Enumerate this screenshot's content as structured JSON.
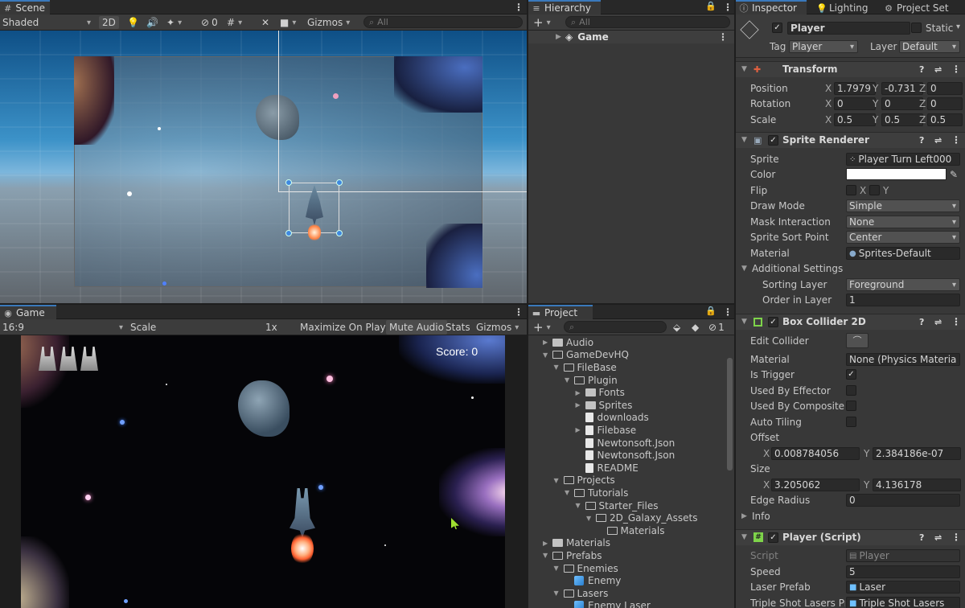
{
  "scene": {
    "tab": "Scene",
    "shading": "Shaded",
    "mode2d": "2D",
    "hidden_count": "0",
    "gizmos": "Gizmos",
    "search_placeholder": "All"
  },
  "game": {
    "tab": "Game",
    "aspect": "16:9",
    "scale_label": "Scale",
    "scale_value": "1x",
    "maximize": "Maximize On Play",
    "mute": "Mute Audio",
    "stats": "Stats",
    "gizmos": "Gizmos",
    "score": "Score: 0",
    "scale_level": 0.0
  },
  "hierarchy": {
    "tab": "Hierarchy",
    "search_placeholder": "All",
    "scene_name": "Game"
  },
  "project": {
    "tab": "Project",
    "hidden_count": "1",
    "items": [
      {
        "label": "Audio",
        "depth": 0,
        "kind": "folder",
        "open": false,
        "arrow": "closed"
      },
      {
        "label": "GameDevHQ",
        "depth": 0,
        "kind": "folder",
        "open": true,
        "arrow": "open"
      },
      {
        "label": "FileBase",
        "depth": 1,
        "kind": "folder",
        "open": true,
        "arrow": "open"
      },
      {
        "label": "Plugin",
        "depth": 2,
        "kind": "folder",
        "open": true,
        "arrow": "open"
      },
      {
        "label": "Fonts",
        "depth": 3,
        "kind": "folder",
        "open": false,
        "arrow": "closed"
      },
      {
        "label": "Sprites",
        "depth": 3,
        "kind": "folder",
        "open": false,
        "arrow": "closed"
      },
      {
        "label": "downloads",
        "depth": 3,
        "kind": "doc",
        "open": false,
        "arrow": "none"
      },
      {
        "label": "Filebase",
        "depth": 3,
        "kind": "doc",
        "open": false,
        "arrow": "closed"
      },
      {
        "label": "Newtonsoft.Json",
        "depth": 3,
        "kind": "doc",
        "open": false,
        "arrow": "none"
      },
      {
        "label": "Newtonsoft.Json",
        "depth": 3,
        "kind": "doc",
        "open": false,
        "arrow": "none"
      },
      {
        "label": "README",
        "depth": 3,
        "kind": "doc",
        "open": false,
        "arrow": "none"
      },
      {
        "label": "Projects",
        "depth": 1,
        "kind": "folder",
        "open": true,
        "arrow": "open"
      },
      {
        "label": "Tutorials",
        "depth": 2,
        "kind": "folder",
        "open": true,
        "arrow": "open"
      },
      {
        "label": "Starter_Files",
        "depth": 3,
        "kind": "folder",
        "open": true,
        "arrow": "open"
      },
      {
        "label": "2D_Galaxy_Assets",
        "depth": 4,
        "kind": "folder",
        "open": true,
        "arrow": "open"
      },
      {
        "label": "Materials",
        "depth": 5,
        "kind": "folder",
        "open": true,
        "arrow": "none"
      },
      {
        "label": "Materials",
        "depth": 0,
        "kind": "folder",
        "open": false,
        "arrow": "closed"
      },
      {
        "label": "Prefabs",
        "depth": 0,
        "kind": "folder",
        "open": true,
        "arrow": "open"
      },
      {
        "label": "Enemies",
        "depth": 1,
        "kind": "folder",
        "open": true,
        "arrow": "open"
      },
      {
        "label": "Enemy",
        "depth": 2,
        "kind": "prefab",
        "open": false,
        "arrow": "none"
      },
      {
        "label": "Lasers",
        "depth": 1,
        "kind": "folder",
        "open": true,
        "arrow": "open"
      },
      {
        "label": "Enemy Laser",
        "depth": 2,
        "kind": "prefab",
        "open": false,
        "arrow": "none"
      }
    ]
  },
  "inspector": {
    "tabs": {
      "inspector": "Inspector",
      "lighting": "Lighting",
      "project_settings": "Project Set"
    },
    "object_name": "Player",
    "static_label": "Static",
    "tag_label": "Tag",
    "tag_value": "Player",
    "layer_label": "Layer",
    "layer_value": "Default",
    "transform": {
      "title": "Transform",
      "position": "Position",
      "rotation": "Rotation",
      "scale": "Scale",
      "px": "1.7979",
      "py": "-0.731",
      "pz": "0",
      "rx": "0",
      "ry": "0",
      "rz": "0",
      "sx": "0.5",
      "sy": "0.5",
      "sz": "0.5"
    },
    "sprite_renderer": {
      "title": "Sprite Renderer",
      "sprite_label": "Sprite",
      "sprite_value": "Player Turn Left000",
      "color_label": "Color",
      "flip_label": "Flip",
      "flip_x": "X",
      "flip_y": "Y",
      "draw_mode_label": "Draw Mode",
      "draw_mode": "Simple",
      "mask_label": "Mask Interaction",
      "mask": "None",
      "sort_point_label": "Sprite Sort Point",
      "sort_point": "Center",
      "material_label": "Material",
      "material": "Sprites-Default",
      "additional": "Additional Settings",
      "sorting_layer_label": "Sorting Layer",
      "sorting_layer": "Foreground",
      "order_label": "Order in Layer",
      "order": "1"
    },
    "box_collider": {
      "title": "Box Collider 2D",
      "edit_label": "Edit Collider",
      "material_label": "Material",
      "material": "None (Physics Materia",
      "trigger_label": "Is Trigger",
      "effector_label": "Used By Effector",
      "composite_label": "Used By Composite",
      "tiling_label": "Auto Tiling",
      "offset_label": "Offset",
      "offset_x": "0.008784056",
      "offset_y": "2.384186e-07",
      "size_label": "Size",
      "size_x": "3.205062",
      "size_y": "4.136178",
      "edge_label": "Edge Radius",
      "edge": "0",
      "info_label": "Info"
    },
    "player_script": {
      "title": "Player (Script)",
      "script_label": "Script",
      "script": "Player",
      "speed_label": "Speed",
      "speed": "5",
      "laser_label": "Laser Prefab",
      "laser": "Laser",
      "triple_label": "Triple Shot Lasers Pre",
      "triple": "Triple Shot Lasers"
    },
    "axis": {
      "x": "X",
      "y": "Y",
      "z": "Z"
    }
  }
}
